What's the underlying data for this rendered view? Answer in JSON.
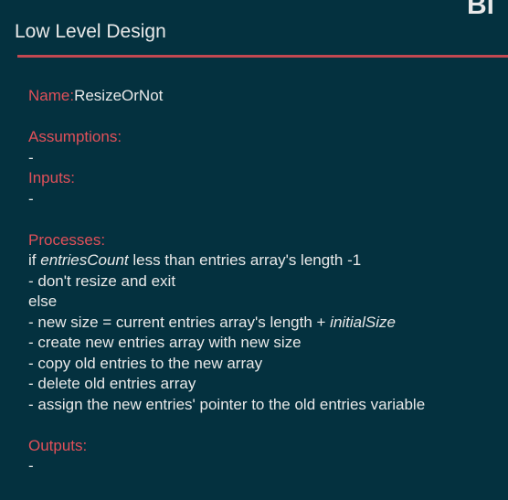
{
  "header": {
    "logo_fragment": "Bl",
    "title": "Low Level Design"
  },
  "colors": {
    "background": "#04313f",
    "accent": "#c24851",
    "label": "#e05059",
    "text": "#e9e9e9"
  },
  "name": {
    "label": "Name:",
    "value": "ResizeOrNot"
  },
  "assumptions": {
    "label": "Assumptions:",
    "value": "-"
  },
  "inputs": {
    "label": "Inputs:",
    "value": "-"
  },
  "processes": {
    "label": "Processes:",
    "if_prefix": "if ",
    "if_var": "entriesCount",
    "if_suffix": " less than entries array's length -1",
    "dont_resize": "- don't resize and exit",
    "else": "else",
    "new_size_prefix": "- new size = current entries array's length + ",
    "new_size_var": "initialSize",
    "create": "- create new entries array with new size",
    "copy": "- copy old entries to the new array",
    "delete": "- delete old entries array",
    "assign": "- assign the new entries' pointer to the old entries variable"
  },
  "outputs": {
    "label": "Outputs:",
    "value": "-"
  }
}
